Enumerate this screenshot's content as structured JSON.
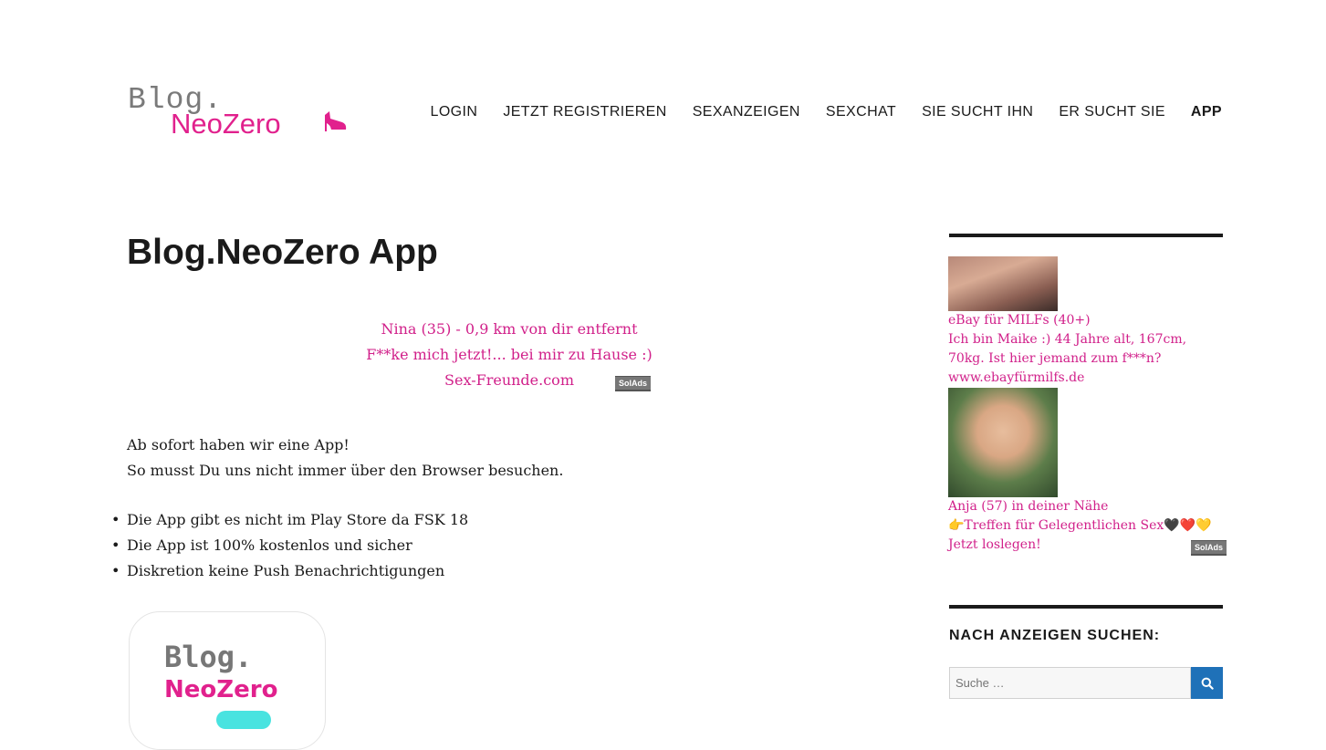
{
  "header": {
    "logo_line1": "Blog.",
    "logo_line2": "NeoZero",
    "nav": [
      {
        "label": "LOGIN"
      },
      {
        "label": "JETZT REGISTRIEREN"
      },
      {
        "label": "SEXANZEIGEN"
      },
      {
        "label": "SEXCHAT"
      },
      {
        "label": "SIE SUCHT IHN"
      },
      {
        "label": "ER SUCHT SIE"
      },
      {
        "label": "APP",
        "active": true
      }
    ]
  },
  "main": {
    "title": "Blog.NeoZero App",
    "ad": {
      "line1": "Nina (35) - 0,9 km von dir entfernt",
      "line2": "F**ke mich jetzt!... bei mir zu Hause :)",
      "line3": "Sex-Freunde.com",
      "badge": "SolAds"
    },
    "intro": [
      "Ab sofort haben wir eine App!",
      "So musst Du uns nicht immer über den Browser besuchen."
    ],
    "features": [
      "Die App gibt es nicht im Play Store da FSK 18",
      "Die App ist 100% kostenlos und sicher",
      "Diskretion keine Push Benachrichtigungen"
    ],
    "app_icon": {
      "line1": "Blog.",
      "line2": "NeoZero"
    }
  },
  "sidebar": {
    "ad": {
      "item1": {
        "title": "eBay für MILFs (40+)",
        "text": "Ich bin Maike :) 44 Jahre alt, 167cm, 70kg. Ist hier jemand zum f***n?",
        "url": "www.ebayfürmilfs.de"
      },
      "item2": {
        "title": "Anja (57) in deiner Nähe",
        "text": "👉Treffen für Gelegentlichen Sex🖤❤️💛",
        "cta": "Jetzt loslegen!"
      },
      "badge": "SolAds"
    },
    "search": {
      "title": "NACH ANZEIGEN SUCHEN:",
      "placeholder": "Suche …"
    }
  },
  "colors": {
    "accent": "#e1218d",
    "ad_text": "#d1208a",
    "search_button": "#1f71b8"
  }
}
